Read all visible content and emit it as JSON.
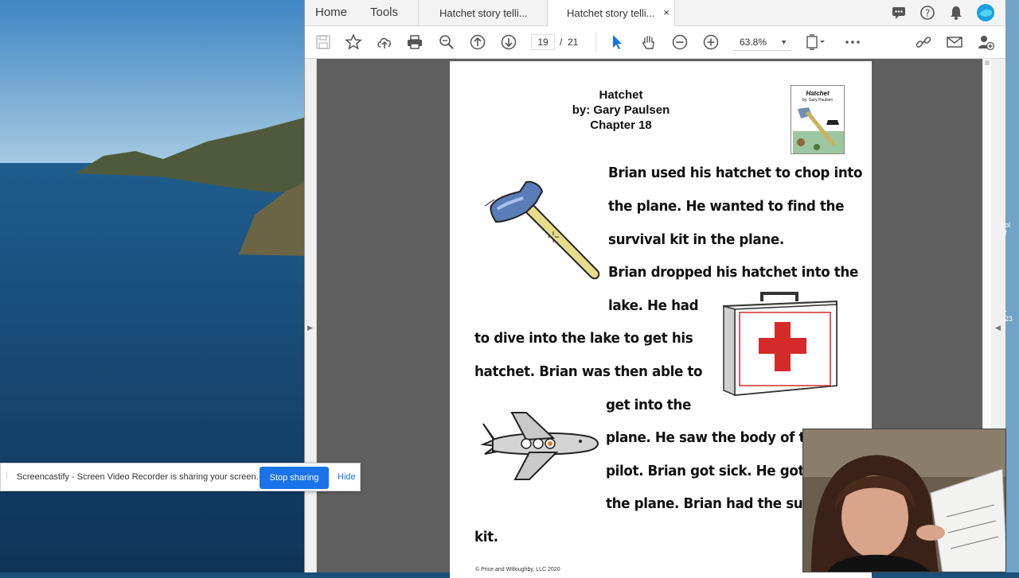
{
  "tabs": {
    "home": "Home",
    "tools": "Tools",
    "tab1": "Hatchet story telli...",
    "tab2": "Hatchet story telli...",
    "close": "×"
  },
  "toolbar": {
    "current_page": "19",
    "page_sep": "/",
    "page_total": "21",
    "zoom": "63.8%"
  },
  "document": {
    "title": "Hatchet",
    "author": "by: Gary Paulsen",
    "chapter": "Chapter 18",
    "cover_title": "Hatchet",
    "cover_author": "by: Gary Paulsen",
    "lines": [
      "Brian used his hatchet to chop into",
      "the plane. He wanted to find the",
      "survival kit in the plane.",
      "Brian dropped his hatchet into the",
      "lake. He had",
      "to dive into the lake to get his",
      "hatchet. Brian was then able to",
      "get into the",
      "plane. He saw the body of the de",
      "pilot. Brian got sick. He got out o",
      "the plane. Brian had the surviva",
      "kit."
    ],
    "footer": "© Price and Willoughby, LLC 2020"
  },
  "notification": {
    "message": "Screencastify - Screen Video Recorder is sharing your screen.",
    "stop": "Stop sharing",
    "hide": "Hide"
  },
  "side": {
    "text1": "ol\nf",
    "text2": "-\n23"
  },
  "colors": {
    "accent": "#1a73e8",
    "red_cross": "#d42a2a"
  }
}
